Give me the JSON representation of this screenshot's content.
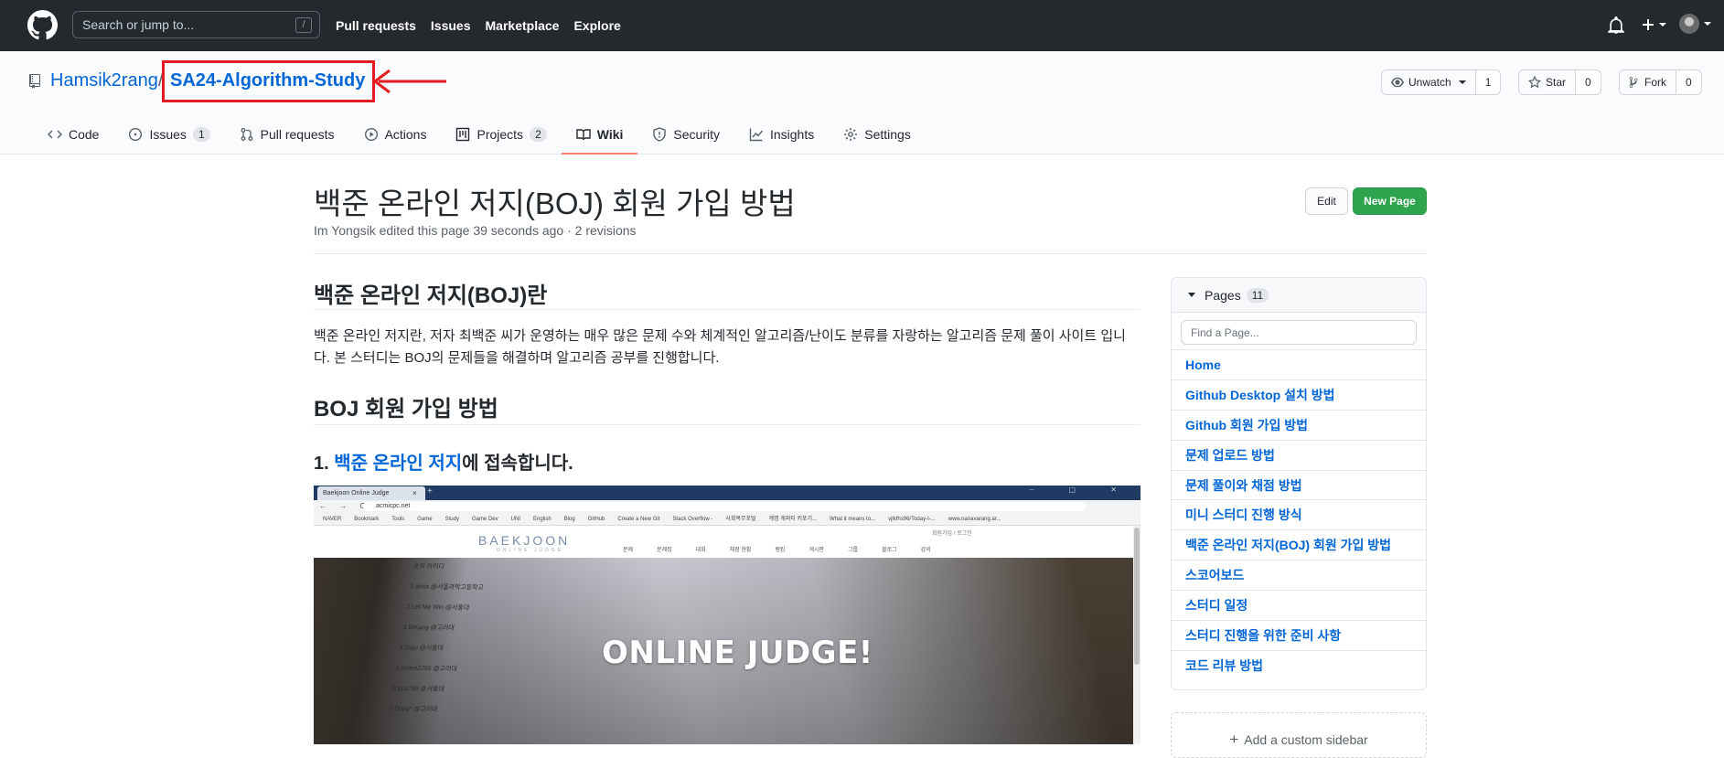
{
  "header": {
    "search_placeholder": "Search or jump to...",
    "search_key": "/",
    "nav": [
      "Pull requests",
      "Issues",
      "Marketplace",
      "Explore"
    ]
  },
  "repo": {
    "owner": "Hamsik2rang",
    "separator": "/",
    "name": "SA24-Algorithm-Study",
    "annotation_color": "#e41b23",
    "watch": {
      "label": "Unwatch",
      "count": "1"
    },
    "star": {
      "label": "Star",
      "count": "0"
    },
    "fork": {
      "label": "Fork",
      "count": "0"
    },
    "tabs": [
      {
        "label": "Code",
        "icon": "code-icon",
        "counter": ""
      },
      {
        "label": "Issues",
        "icon": "issue-icon",
        "counter": "1"
      },
      {
        "label": "Pull requests",
        "icon": "pull-request-icon",
        "counter": ""
      },
      {
        "label": "Actions",
        "icon": "play-icon",
        "counter": ""
      },
      {
        "label": "Projects",
        "icon": "project-icon",
        "counter": "2"
      },
      {
        "label": "Wiki",
        "icon": "book-icon",
        "counter": ""
      },
      {
        "label": "Security",
        "icon": "shield-icon",
        "counter": ""
      },
      {
        "label": "Insights",
        "icon": "graph-icon",
        "counter": ""
      },
      {
        "label": "Settings",
        "icon": "gear-icon",
        "counter": ""
      }
    ],
    "active_tab": "Wiki"
  },
  "wiki": {
    "title": "백준 온라인 저지(BOJ) 회원 가입 방법",
    "meta": "Im Yongsik edited this page 39 seconds ago · 2 revisions",
    "edit_label": "Edit",
    "new_page_label": "New Page",
    "section1_heading": "백준 온라인 저지(BOJ)란",
    "section1_text": "백준 온라인 저지란, 저자 최백준 씨가 운영하는 매우 많은 문제 수와 체계적인 알고리즘/난이도 분류를 자랑하는 알고리즘 문제 풀이 사이트 입니다. 본 스터디는 BOJ의 문제들을 해결하며 알고리즘 공부를 진행합니다.",
    "section2_heading": "BOJ 회원 가입 방법",
    "step1_prefix": "1. ",
    "step1_link": "백준 온라인 저지",
    "step1_suffix": "에 접속합니다.",
    "screenshot": {
      "tab_title": "Baekjoon Online Judge",
      "tab_close": "×",
      "new_tab": "+",
      "window_controls": "– ▢ ✕",
      "nav_buttons": "← → C ⌂",
      "url": "acmicpc.net",
      "bookmarks": [
        "NAVER",
        "Bookmark",
        "Tools",
        "Game",
        "Study",
        "Game Dev",
        "UNI",
        "English",
        "Blog",
        "GitHub",
        "Create a New Git",
        "Stack Overflow -",
        "사회복무포털",
        "계명 캐퍼티 키포기...",
        "What it means to...",
        "vjlkfhs96/Today-I-...",
        "www.nanavarang.ar..."
      ],
      "logo": "BAEKJOON",
      "logo_sub": "ONLINE JUDGE",
      "login_links": "회원가입 / 로그인",
      "menu": [
        "문제",
        "문제집",
        "대회",
        "채점 현황",
        "랭킹",
        "게시판",
        "그룹",
        "블로그",
        "강의"
      ],
      "hero_text": "ONLINE JUDGE!",
      "hero_rows": [
        "순위   아이디",
        "1   ainta @서울과학고등학교",
        "2   Let Me Win @서울대",
        "3   BiKang @고려대",
        "4   Doju @서울대",
        "5   wclee2265 @고려대",
        "6   pps789 @서울대",
        "7   Dopa* @고려대"
      ]
    }
  },
  "sidebar": {
    "pages_label": "Pages",
    "pages_count": "11",
    "filter_placeholder": "Find a Page...",
    "pages": [
      "Home",
      "Github Desktop 설치 방법",
      "Github 회원 가입 방법",
      "문제 업로드 방법",
      "문제 풀이와 채점 방법",
      "미니 스터디 진행 방식",
      "백준 온라인 저지(BOJ) 회원 가입 방법",
      "스코어보드",
      "스터디 일정",
      "스터디 진행을 위한 준비 사항",
      "코드 리뷰 방법"
    ],
    "custom_sidebar_icon": "+",
    "custom_sidebar_label": "Add a custom sidebar"
  }
}
